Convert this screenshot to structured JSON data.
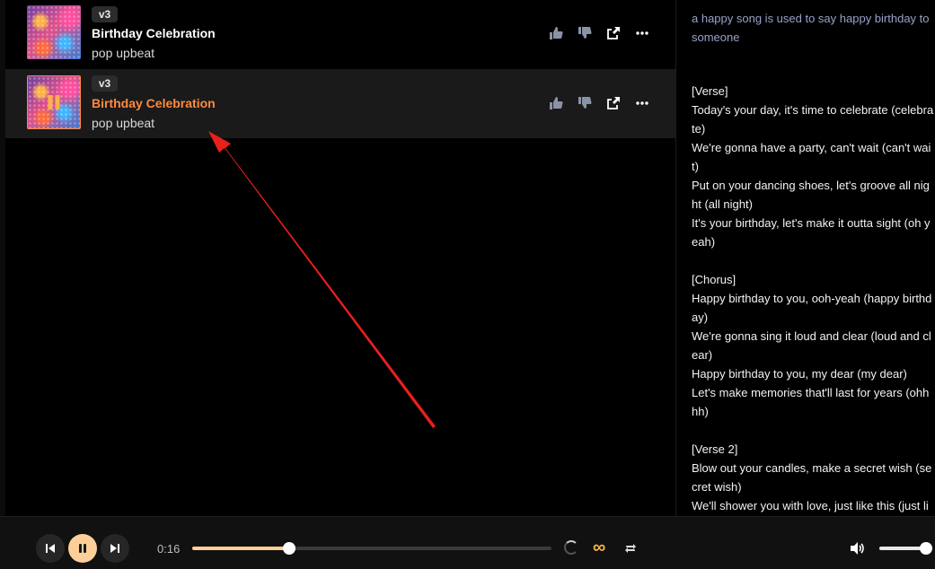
{
  "songs": [
    {
      "version": "v3",
      "title": "Birthday Celebration",
      "style": "pop upbeat",
      "active": false
    },
    {
      "version": "v3",
      "title": "Birthday Celebration",
      "style": "pop upbeat",
      "active": true
    }
  ],
  "row_icons": [
    "thumbs-up-icon",
    "thumbs-down-icon",
    "share-icon",
    "more-icon"
  ],
  "details": {
    "prompt": "a happy song is used to say happy birthday to someone",
    "lyrics": "[Verse]\nToday's your day, it's time to celebrate (celebrate)\nWe're gonna have a party, can't wait (can't wait)\nPut on your dancing shoes, let's groove all night (all night)\nIt's your birthday, let's make it outta sight (oh yeah)\n\n[Chorus]\nHappy birthday to you, ooh-yeah (happy birthday)\nWe're gonna sing it loud and clear (loud and clear)\nHappy birthday to you, my dear (my dear)\nLet's make memories that'll last for years (ohhhh)\n\n[Verse 2]\nBlow out your candles, make a secret wish (secret wish)\nWe'll shower you with love, just like this (just like this)"
  },
  "player": {
    "time": "0:16",
    "progress_percent": 27,
    "volume_percent": 100,
    "state": "playing",
    "infinity_symbol": "∞"
  },
  "colors": {
    "accent": "#ff8a3d",
    "player_accent": "#ffcf99",
    "prompt": "#9aa0c8",
    "annotation_arrow": "#e8201c"
  }
}
